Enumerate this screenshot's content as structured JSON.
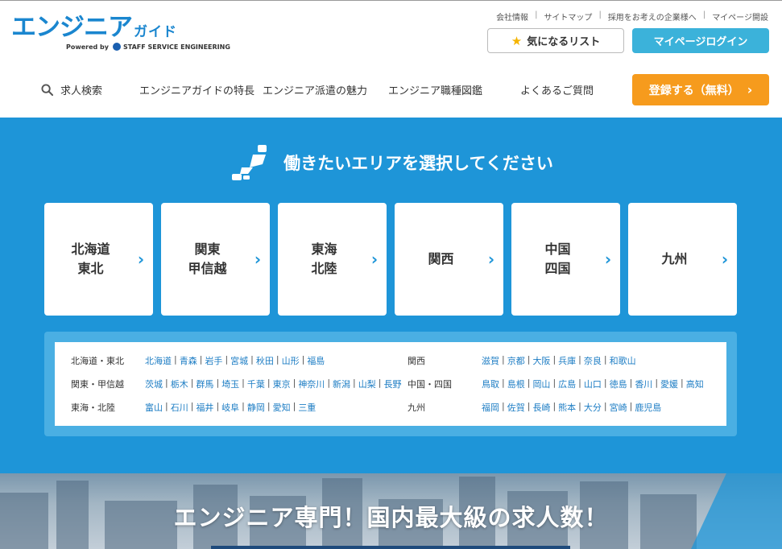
{
  "header": {
    "logo_main": "エンジニア",
    "logo_small": "ガイド",
    "logo_powered": "Powered by",
    "logo_company": "STAFF SERVICE ENGINEERING",
    "util_links": [
      "会社情報",
      "サイトマップ",
      "採用をお考えの企業様へ",
      "マイページ開設"
    ],
    "util_sep": "|",
    "fav_label": "気になるリスト",
    "login_label": "マイページログイン",
    "register_label": "登録する（無料）",
    "register_arrow": "›"
  },
  "nav": {
    "search": "求人検索",
    "features": "エンジニアガイドの特長",
    "dispatch": "エンジニア派遣の魅力",
    "jobtypes": "エンジニア職種図鑑",
    "faq": "よくあるご質問"
  },
  "area": {
    "title": "働きたいエリアを選択してください",
    "chevron": "›",
    "regions": [
      {
        "line1": "北海道",
        "line2": "東北"
      },
      {
        "line1": "関東",
        "line2": "甲信越"
      },
      {
        "line1": "東海",
        "line2": "北陸"
      },
      {
        "line1": "関西",
        "line2": ""
      },
      {
        "line1": "中国",
        "line2": "四国"
      },
      {
        "line1": "九州",
        "line2": ""
      }
    ],
    "pref_sep": "|",
    "pref_groups": [
      {
        "label": "北海道・東北",
        "prefs": [
          "北海道",
          "青森",
          "岩手",
          "宮城",
          "秋田",
          "山形",
          "福島"
        ]
      },
      {
        "label": "関東・甲信越",
        "prefs": [
          "茨城",
          "栃木",
          "群馬",
          "埼玉",
          "千葉",
          "東京",
          "神奈川",
          "新潟",
          "山梨",
          "長野"
        ]
      },
      {
        "label": "東海・北陸",
        "prefs": [
          "富山",
          "石川",
          "福井",
          "岐阜",
          "静岡",
          "愛知",
          "三重"
        ]
      },
      {
        "label": "関西",
        "prefs": [
          "滋賀",
          "京都",
          "大阪",
          "兵庫",
          "奈良",
          "和歌山"
        ]
      },
      {
        "label": "中国・四国",
        "prefs": [
          "鳥取",
          "島根",
          "岡山",
          "広島",
          "山口",
          "徳島",
          "香川",
          "愛媛",
          "高知"
        ]
      },
      {
        "label": "九州",
        "prefs": [
          "福岡",
          "佐賀",
          "長崎",
          "熊本",
          "大分",
          "宮崎",
          "鹿児島"
        ]
      }
    ]
  },
  "hero": {
    "headline": "エンジニア専門！国内最大級の求人数！"
  },
  "colors": {
    "brand_blue": "#1e95d8",
    "logo_blue": "#1a86cf",
    "login_cyan": "#3bb2da",
    "register_orange": "#f69b1d",
    "pref_link": "#1d7dc4",
    "star": "#f5b400"
  },
  "icons": {
    "fav": "star-icon",
    "search": "magnifier-icon",
    "area": "japan-map-icon",
    "region": "chevron-right-icon"
  }
}
